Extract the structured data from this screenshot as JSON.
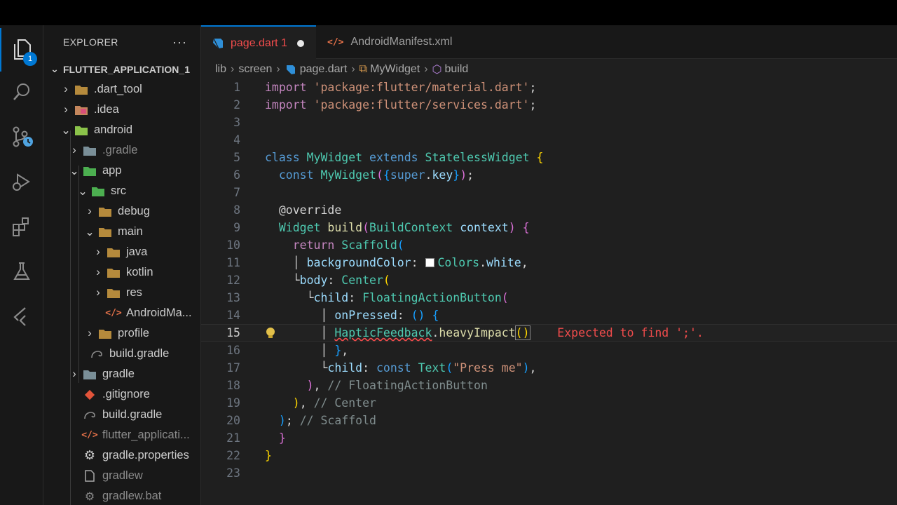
{
  "explorer": {
    "title": "EXPLORER",
    "more": "···",
    "badge_count": "1",
    "root": "FLUTTER_APPLICATION_1",
    "items": [
      {
        "label": ".dart_tool",
        "icon": "folder-icon"
      },
      {
        "label": ".idea",
        "icon": "folder-idea-icon"
      },
      {
        "label": "android",
        "icon": "folder-android-icon"
      },
      {
        "label": ".gradle",
        "icon": "folder-gradle-icon"
      },
      {
        "label": "app",
        "icon": "folder-app-icon"
      },
      {
        "label": "src",
        "icon": "folder-src-icon"
      },
      {
        "label": "debug",
        "icon": "folder-icon"
      },
      {
        "label": "main",
        "icon": "folder-open-icon"
      },
      {
        "label": "java",
        "icon": "folder-icon"
      },
      {
        "label": "kotlin",
        "icon": "folder-icon"
      },
      {
        "label": "res",
        "icon": "folder-icon"
      },
      {
        "label": "AndroidMa...",
        "icon": "xml-file-icon"
      },
      {
        "label": "profile",
        "icon": "folder-icon"
      },
      {
        "label": "build.gradle",
        "icon": "gradle-file-icon"
      },
      {
        "label": "gradle",
        "icon": "folder-gradle-icon"
      },
      {
        "label": ".gitignore",
        "icon": "git-file-icon"
      },
      {
        "label": "build.gradle",
        "icon": "gradle-file-icon"
      },
      {
        "label": "flutter_applicati...",
        "icon": "xml-file-icon"
      },
      {
        "label": "gradle.properties",
        "icon": "gear-file-icon"
      },
      {
        "label": "gradlew",
        "icon": "file-icon"
      },
      {
        "label": "gradlew.bat",
        "icon": "gear-file-icon"
      }
    ]
  },
  "tabs": [
    {
      "label": "page.dart 1",
      "icon": "dart-icon",
      "active": true,
      "modified": true
    },
    {
      "label": "AndroidManifest.xml",
      "icon": "xml-file-icon",
      "active": false
    }
  ],
  "breadcrumb": [
    "lib",
    "screen",
    "page.dart",
    "MyWidget",
    "build"
  ],
  "editor": {
    "line_numbers": [
      "1",
      "2",
      "3",
      "4",
      "5",
      "6",
      "7",
      "8",
      "9",
      "10",
      "11",
      "12",
      "13",
      "14",
      "15",
      "16",
      "17",
      "18",
      "19",
      "20",
      "21",
      "22",
      "23"
    ],
    "current_line": "15",
    "error_message": "Expected to find ';'."
  },
  "colors": {
    "accent": "#0078d4",
    "error": "#f14c4c",
    "keyword": "#569cd6",
    "string": "#ce9178",
    "class": "#4ec9b0"
  }
}
